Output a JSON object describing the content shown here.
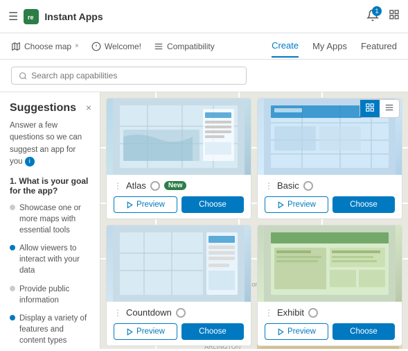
{
  "header": {
    "menu_icon": "☰",
    "app_logo": "re",
    "app_title": "Instant Apps",
    "notification_count": "1",
    "grid_icon": "⣿"
  },
  "top_nav": {
    "items": [
      {
        "icon": "🗺",
        "label": "Choose map"
      },
      {
        "icon": "🔔",
        "label": "Welcome!"
      },
      {
        "icon": "≡",
        "label": "Compatibility"
      }
    ],
    "close_icon": "×",
    "tabs": [
      {
        "label": "Create",
        "active": true
      },
      {
        "label": "My Apps",
        "active": false
      },
      {
        "label": "Featured",
        "active": false
      }
    ]
  },
  "search": {
    "placeholder": "Search app capabilities"
  },
  "sidebar": {
    "title": "Suggestions",
    "description": "Answer a few questions so we can suggest an app for you",
    "close_icon": "×",
    "question": "1. What is your goal for the app?",
    "options": [
      {
        "text": "Showcase one or more maps with essential tools",
        "active": false
      },
      {
        "text": "Allow viewers to interact with your data",
        "active": true
      },
      {
        "text": "Provide public information",
        "active": false
      },
      {
        "text": "Display a variety of features and content types",
        "active": false
      }
    ]
  },
  "view_toggle": {
    "grid_label": "⊞",
    "list_label": "≡"
  },
  "cards": [
    {
      "id": "atlas",
      "name": "Atlas",
      "badge": "New",
      "has_badge": true,
      "preview_label": "Preview",
      "choose_label": "Choose"
    },
    {
      "id": "basic",
      "name": "Basic",
      "badge": "",
      "has_badge": false,
      "preview_label": "Preview",
      "choose_label": "Choose"
    },
    {
      "id": "countdown",
      "name": "Countdown",
      "badge": "",
      "has_badge": false,
      "preview_label": "Preview",
      "choose_label": "Choose"
    },
    {
      "id": "exhibit",
      "name": "Exhibit",
      "badge": "",
      "has_badge": false,
      "preview_label": "Preview",
      "choose_label": "Choose"
    }
  ]
}
